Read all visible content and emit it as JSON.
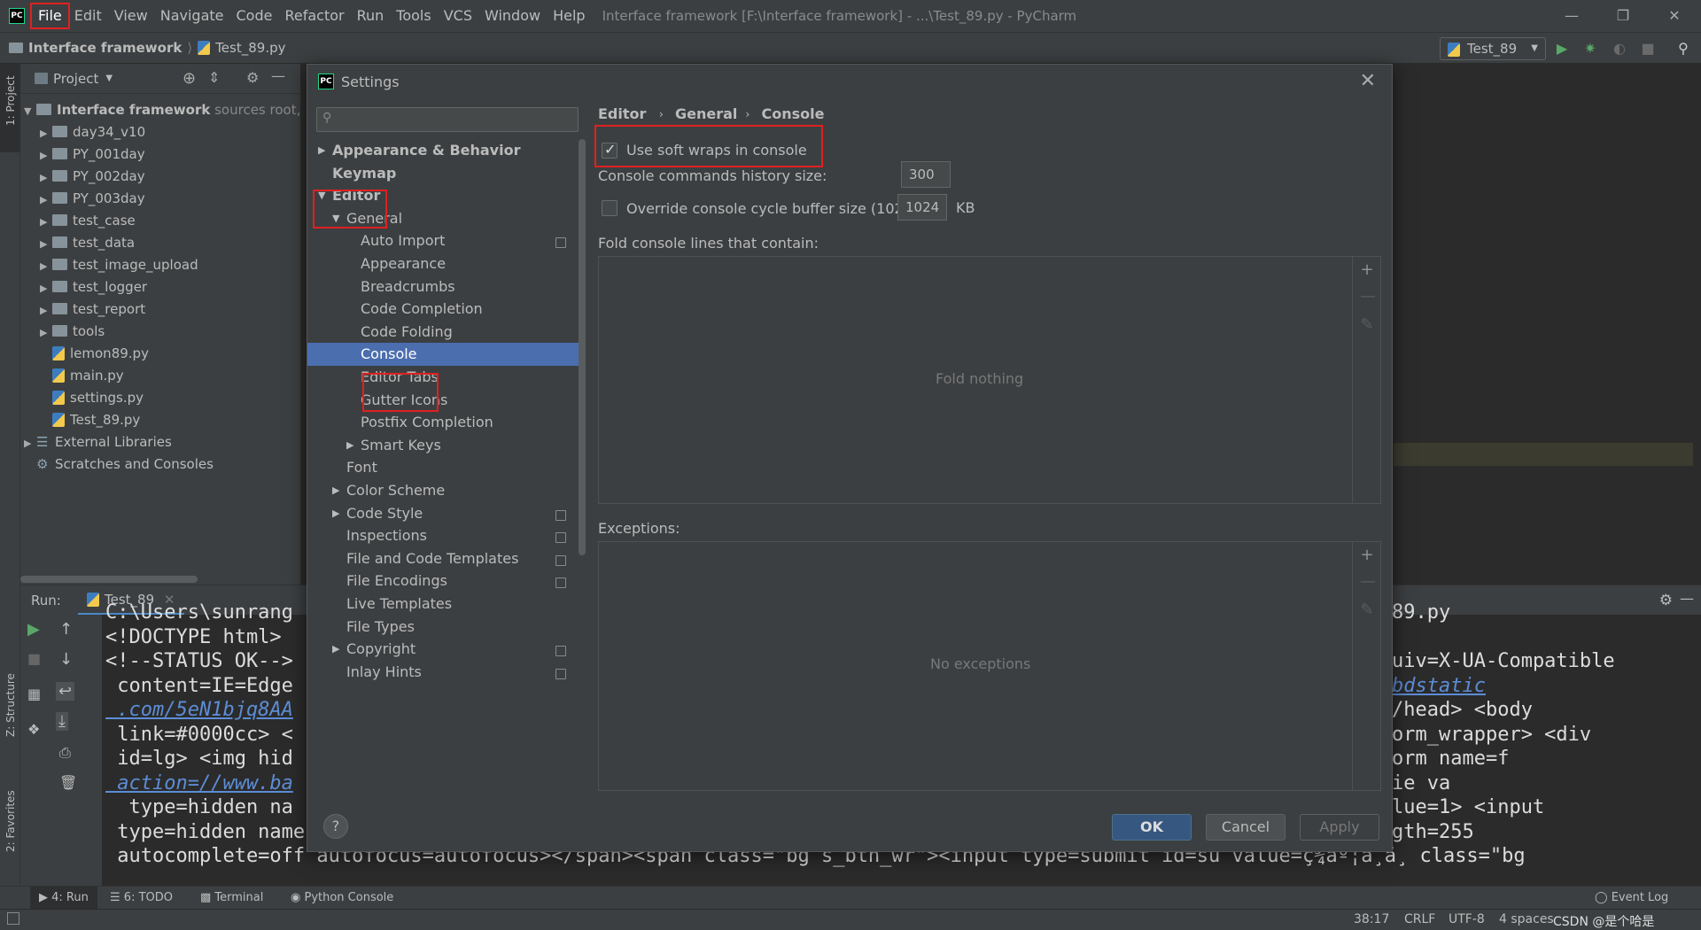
{
  "menubar": {
    "items": [
      "File",
      "Edit",
      "View",
      "Navigate",
      "Code",
      "Refactor",
      "Run",
      "Tools",
      "VCS",
      "Window",
      "Help"
    ],
    "title": "Interface framework [F:\\Interface framework] - ...\\Test_89.py - PyCharm"
  },
  "navbar": {
    "project": "Interface framework",
    "file": "Test_89.py",
    "run_config": "Test_89"
  },
  "project_panel": {
    "header": "Project",
    "root": "Interface framework",
    "root_suffix": "sources root,",
    "folders": [
      "day34_v10",
      "PY_001day",
      "PY_002day",
      "PY_003day",
      "test_case",
      "test_data",
      "test_image_upload",
      "test_logger",
      "test_report",
      "tools"
    ],
    "files": [
      "lemon89.py",
      "main.py",
      "settings.py",
      "Test_89.py"
    ],
    "external": "External Libraries",
    "scratches": "Scratches and Consoles"
  },
  "left_strip": {
    "project": "1: Project",
    "structure": "Z: Structure",
    "favorites": "2: Favorites"
  },
  "run_panel": {
    "label": "Run:",
    "tab": "Test_89",
    "lines": [
      "C:\\Users\\sunrang",
      "<!DOCTYPE html>",
      "<!--STATUS OK-->",
      " content=IE=Edge",
      " .com/5eN1bjq8AA",
      " link=#0000cc> <",
      " id=lg> <img hid",
      " action=//www.ba",
      "  type=hidden na",
      " type=hidden name",
      " autocomplete=off autofocus=autofocus></span><span class=\"bg s_btn_wr\"><input type=submit id=su value=ç¾åº¦ä¸ä¸ class=\"bg"
    ],
    "right_lines": [
      "89.py",
      "uiv=X-UA-Compatible",
      "bdstatic",
      "/head> <body",
      "orm_wrapper> <div",
      "orm name=f",
      "ie va",
      "lue=1> <input",
      "gth=255"
    ]
  },
  "tool_tabs": [
    "4: Run",
    "6: TODO",
    "Terminal",
    "Python Console"
  ],
  "event_log": "Event Log",
  "status": {
    "position": "38:17",
    "line_sep": "CRLF",
    "encoding": "UTF-8",
    "indent": "4 spaces",
    "watermark": "CSDN @是个哈是"
  },
  "dialog": {
    "title": "Settings",
    "search_placeholder": "",
    "tree": [
      {
        "label": "Appearance & Behavior",
        "level": 0,
        "arrow": "right",
        "bold": true
      },
      {
        "label": "Keymap",
        "level": 0,
        "arrow": "",
        "bold": true
      },
      {
        "label": "Editor",
        "level": 0,
        "arrow": "down",
        "bold": true
      },
      {
        "label": "General",
        "level": 1,
        "arrow": "down"
      },
      {
        "label": "Auto Import",
        "level": 2,
        "badge": true
      },
      {
        "label": "Appearance",
        "level": 2
      },
      {
        "label": "Breadcrumbs",
        "level": 2
      },
      {
        "label": "Code Completion",
        "level": 2
      },
      {
        "label": "Code Folding",
        "level": 2
      },
      {
        "label": "Console",
        "level": 2,
        "selected": true
      },
      {
        "label": "Editor Tabs",
        "level": 2
      },
      {
        "label": "Gutter Icons",
        "level": 2
      },
      {
        "label": "Postfix Completion",
        "level": 2
      },
      {
        "label": "Smart Keys",
        "level": 2,
        "arrow": "right"
      },
      {
        "label": "Font",
        "level": 1
      },
      {
        "label": "Color Scheme",
        "level": 1,
        "arrow": "right"
      },
      {
        "label": "Code Style",
        "level": 1,
        "arrow": "right",
        "badge": true
      },
      {
        "label": "Inspections",
        "level": 1,
        "badge": true
      },
      {
        "label": "File and Code Templates",
        "level": 1,
        "badge": true
      },
      {
        "label": "File Encodings",
        "level": 1,
        "badge": true
      },
      {
        "label": "Live Templates",
        "level": 1
      },
      {
        "label": "File Types",
        "level": 1
      },
      {
        "label": "Copyright",
        "level": 1,
        "arrow": "right",
        "badge": true
      },
      {
        "label": "Inlay Hints",
        "level": 1,
        "badge": true
      }
    ],
    "breadcrumb": [
      "Editor",
      "General",
      "Console"
    ],
    "soft_wraps_label": "Use soft wraps in console",
    "soft_wraps_checked": true,
    "history_label": "Console commands history size:",
    "history_value": "300",
    "override_label": "Override console cycle buffer size (1024 KB)",
    "override_checked": false,
    "buffer_value": "1024",
    "buffer_unit": "KB",
    "fold_label": "Fold console lines that contain:",
    "fold_empty": "Fold nothing",
    "exceptions_label": "Exceptions:",
    "exceptions_empty": "No exceptions",
    "help": "?",
    "ok": "OK",
    "cancel": "Cancel",
    "apply": "Apply"
  },
  "colors": {
    "accent": "#4b6eaf",
    "highlight": "#e02020",
    "ok_button": "#365880"
  }
}
